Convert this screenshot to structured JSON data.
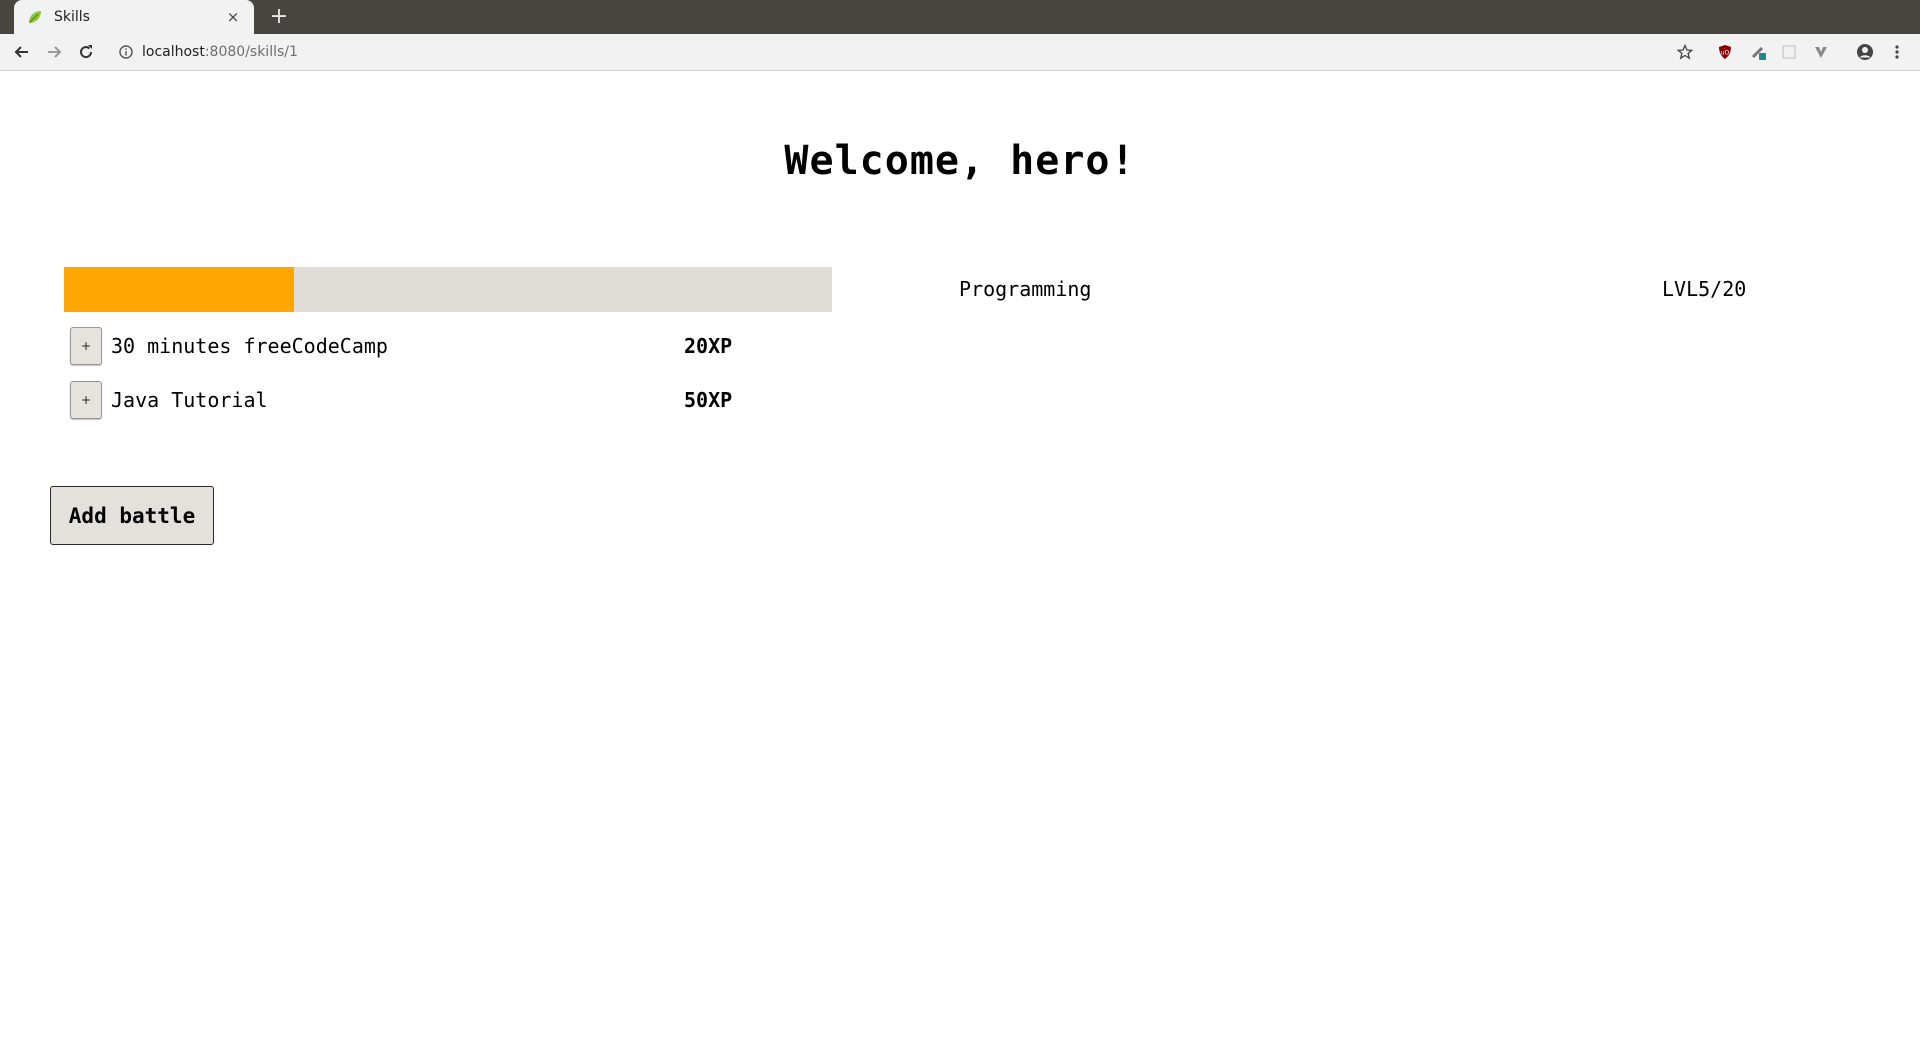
{
  "browser": {
    "tab_title": "Skills",
    "tab_close": "×",
    "new_tab": "+",
    "url_host": "localhost",
    "url_path": ":8080/skills/1",
    "icons": [
      "back-arrow-icon",
      "forward-arrow-icon",
      "reload-icon",
      "site-info-icon",
      "star-icon",
      "ublock-icon",
      "extension-icon",
      "extension-icon",
      "vivaldi-icon",
      "account-icon",
      "menu-icon"
    ]
  },
  "page": {
    "title": "Welcome, hero!"
  },
  "skill": {
    "name": "Programming",
    "level_text": "LVL5/20",
    "progress_percent": 30,
    "colors": {
      "fill": "#ffa500",
      "track": "#dfdbd7"
    }
  },
  "tasks": [
    {
      "add_label": "+",
      "name": "30 minutes freeCodeCamp",
      "xp": "20XP"
    },
    {
      "add_label": "+",
      "name": "Java Tutorial",
      "xp": "50XP"
    }
  ],
  "actions": {
    "add_battle_label": "Add battle"
  }
}
